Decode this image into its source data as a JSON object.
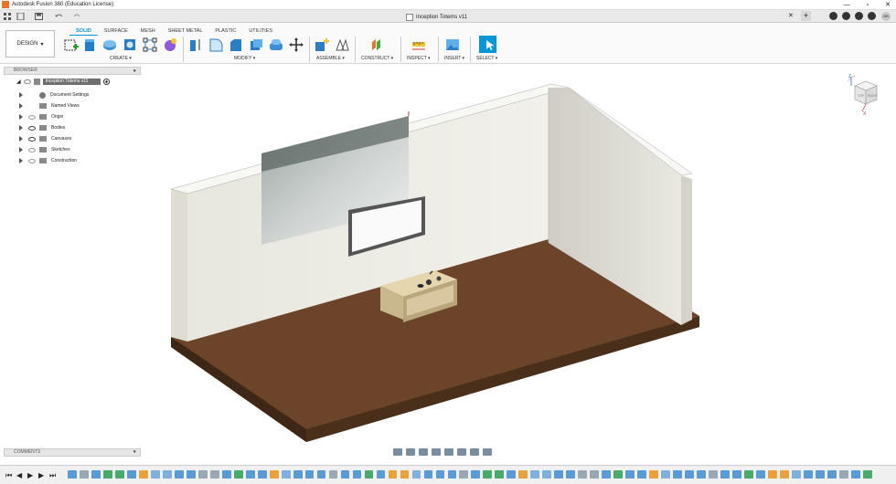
{
  "window": {
    "title": "Autodesk Fusion 360 (Education License)",
    "minimize": "—",
    "maximize": "▫",
    "close": "✕"
  },
  "document": {
    "tab_title": "Inception Totems v11",
    "close": "✕",
    "add": "+"
  },
  "user": {
    "initials": "DB"
  },
  "workspace": {
    "label": "DESIGN"
  },
  "ribbon": {
    "tabs": [
      "SOLID",
      "SURFACE",
      "MESH",
      "SHEET METAL",
      "PLASTIC",
      "UTILITIES"
    ],
    "active_tab": "SOLID",
    "groups": [
      "CREATE",
      "MODIFY",
      "ASSEMBLE",
      "CONSTRUCT",
      "INSPECT",
      "INSERT",
      "SELECT"
    ]
  },
  "browser": {
    "title": "BROWSER",
    "root": "Inception Totems v11",
    "items": [
      {
        "label": "Document Settings",
        "icon": "gear-icon"
      },
      {
        "label": "Named Views",
        "icon": "folder-icon"
      },
      {
        "label": "Origin",
        "icon": "folder-icon"
      },
      {
        "label": "Bodies",
        "icon": "folder-icon"
      },
      {
        "label": "Canvases",
        "icon": "folder-icon"
      },
      {
        "label": "Sketches",
        "icon": "folder-icon"
      },
      {
        "label": "Construction",
        "icon": "folder-icon"
      }
    ]
  },
  "comments": {
    "title": "COMMENTS"
  },
  "viewcube": {
    "top": "TOP",
    "right": "RIGHT",
    "axis_z": "Z",
    "axis_x": "X"
  },
  "colors": {
    "accent": "#0696d7",
    "floor": "#5a3a22",
    "wall": "#eeede6",
    "wood": "#d8c7a0"
  }
}
